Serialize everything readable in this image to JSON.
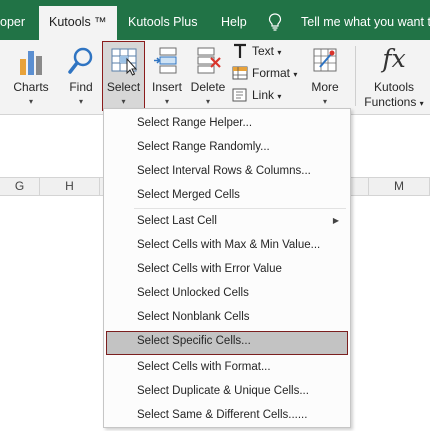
{
  "tabs": [
    {
      "label": "oper"
    },
    {
      "label": "Kutools ™"
    },
    {
      "label": "Kutools Plus"
    },
    {
      "label": "Help"
    }
  ],
  "tell_me": "Tell me what you want to",
  "ribbon": {
    "charts": "Charts",
    "find": "Find",
    "select": "Select",
    "insert": "Insert",
    "delete": "Delete",
    "text": "Text",
    "format": "Format",
    "link": "Link",
    "more": "More",
    "kutools_functions_line1": "Kutools",
    "kutools_functions_line2": "Functions",
    "fx": "fx",
    "dropdown_arrow": "▾"
  },
  "columns": [
    "G",
    "H",
    "M"
  ],
  "menu": {
    "items": [
      {
        "label": "Select Range Helper..."
      },
      {
        "label": "Select Range Randomly..."
      },
      {
        "label": "Select Interval Rows & Columns..."
      },
      {
        "label": "Select Merged Cells"
      },
      {
        "label": "Select Last Cell",
        "submenu": "▶"
      },
      {
        "label": "Select Cells with Max & Min Value..."
      },
      {
        "label": "Select Cells with Error Value"
      },
      {
        "label": "Select Unlocked Cells"
      },
      {
        "label": "Select Nonblank Cells"
      },
      {
        "label": "Select Specific Cells..."
      },
      {
        "label": "Select Cells with Format..."
      },
      {
        "label": "Select Duplicate & Unique Cells..."
      },
      {
        "label": "Select Same & Different Cells......"
      }
    ],
    "highlighted_index": 9
  },
  "colors": {
    "ribbon_tab_bar": "#217346",
    "highlight_border": "#8b1c1c"
  }
}
